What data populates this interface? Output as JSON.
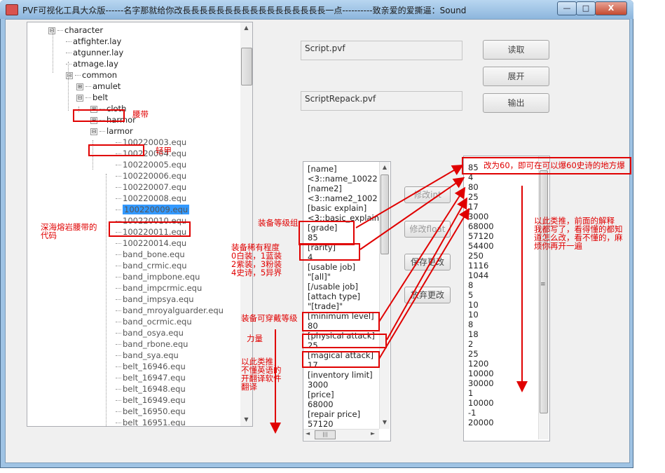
{
  "window": {
    "title": "PVF可视化工具大众版------名字那就给你改長長長長長長長長長長長長長長長長長一点----------致亲爱的爱撕逼：Sound",
    "min_label": "—",
    "max_label": "□",
    "close_label": "X"
  },
  "tree": {
    "nodes": [
      {
        "label": "character",
        "expander": "⊟"
      },
      {
        "label": "atfighter.lay"
      },
      {
        "label": "atgunner.lay"
      },
      {
        "label": "atmage.lay"
      },
      {
        "label": "common",
        "expander": "⊟"
      },
      {
        "label": "amulet",
        "expander": "⊞"
      },
      {
        "label": "belt",
        "expander": "⊟"
      },
      {
        "label": "cloth",
        "expander": "⊞"
      },
      {
        "label": "harmor",
        "expander": "⊞"
      },
      {
        "label": "larmor",
        "expander": "⊟"
      },
      {
        "label": "100220003.equ"
      },
      {
        "label": "100220004.equ"
      },
      {
        "label": "100220005.equ"
      },
      {
        "label": "100220006.equ"
      },
      {
        "label": "100220007.equ"
      },
      {
        "label": "100220008.equ"
      },
      {
        "label": "100220009.equ"
      },
      {
        "label": "100220010.equ"
      },
      {
        "label": "100220011.equ"
      },
      {
        "label": "100220014.equ"
      },
      {
        "label": "band_bone.equ"
      },
      {
        "label": "band_crmic.equ"
      },
      {
        "label": "band_impbone.equ"
      },
      {
        "label": "band_impcrmic.equ"
      },
      {
        "label": "band_impsya.equ"
      },
      {
        "label": "band_mroyalguarder.equ"
      },
      {
        "label": "band_ocrmic.equ"
      },
      {
        "label": "band_osya.equ"
      },
      {
        "label": "band_rbone.equ"
      },
      {
        "label": "band_sya.equ"
      },
      {
        "label": "belt_16946.equ"
      },
      {
        "label": "belt_16947.equ"
      },
      {
        "label": "belt_16948.equ"
      },
      {
        "label": "belt_16949.equ"
      },
      {
        "label": "belt_16950.equ"
      },
      {
        "label": "belt_16951.equ"
      }
    ]
  },
  "files": {
    "script_path": "Script.pvf",
    "repack_path": "ScriptRepack.pvf"
  },
  "buttons": {
    "read": "读取",
    "expand": "展开",
    "export": "输出",
    "modify_int": "修改int",
    "modify_float": "修改float",
    "save_changes": "保存更改",
    "discard_changes": "放弃更改"
  },
  "keys_list": {
    "lines": [
      "[name]",
      "<3::name_10022",
      "[name2]",
      "<3::name2_1002",
      "[basic explain]",
      "<3::basic_explain_",
      "[grade]",
      "85",
      "[rarity]",
      "4",
      "[usable job]",
      "\"[all]\"",
      "[/usable job]",
      "[attach type]",
      "\"[trade]\"",
      "[minimum level]",
      "80",
      "[physical attack]",
      "25",
      "[magical attack]",
      "17",
      "[inventory limit]",
      "3000",
      "[price]",
      "68000",
      "[repair price]",
      "57120"
    ],
    "scroll_left": "◄",
    "scroll_right": "►",
    "grip": "|||"
  },
  "values_list": {
    "lines": [
      "85",
      "4",
      "80",
      "25",
      "17",
      "3000",
      "68000",
      "57120",
      "54400",
      "250",
      "1116",
      "1044",
      "8",
      "5",
      "10",
      "10",
      "8",
      "18",
      "2",
      "25",
      "1200",
      "10000",
      "30000",
      "1",
      "10000",
      "-1",
      "20000"
    ],
    "grip": "≡"
  },
  "annotations": {
    "belt": "腰带",
    "light_armor": "轻甲",
    "belt_code": [
      "深海熔岩腰带的",
      "代码"
    ],
    "grade_group": "装备等级组",
    "rarity": [
      "装备稀有程度",
      "0白装，1蓝装",
      "2紫装，3粉装",
      "4史诗，5异界"
    ],
    "min_level": "装备可穿戴等级",
    "strength": "力量",
    "english_tip": [
      "以此类推，",
      "不懂英语的",
      "开翻译软件",
      "翻译"
    ],
    "value_tip": "改为60，即可在可以爆60史诗的地方爆",
    "right_tip": [
      "以此类推，前面的解释",
      "我都写了，看得懂的都知",
      "道怎么改，看不懂的，麻",
      "烦你再开一遍"
    ]
  },
  "colors": {
    "annotation": "#e00000",
    "selection": "#3399ff",
    "frame": "#9fc3e4"
  }
}
